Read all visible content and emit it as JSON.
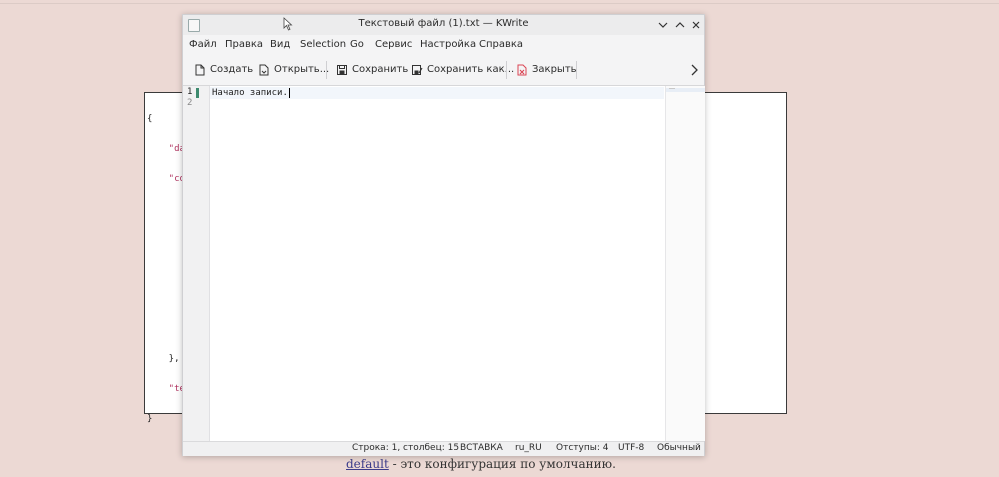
{
  "background": {
    "code_lines": [
      "{",
      "    \"da",
      "    \"co",
      "",
      "",
      "",
      "",
      "",
      "    },",
      "    \"te",
      "}"
    ],
    "footer_link": "default",
    "footer_text": " - это конфигурация по умолчанию."
  },
  "window": {
    "title": "Текстовый файл (1).txt — KWrite",
    "controls": {
      "minimize": "⌄",
      "maximize": "⌃",
      "close": "✕"
    }
  },
  "menu": [
    "Файл",
    "Правка",
    "Вид",
    "Selection",
    "Go",
    "Сервис",
    "Настройка",
    "Справка"
  ],
  "toolbar": {
    "new_label": "Создать",
    "open_label": "Открыть...",
    "save_label": "Сохранить",
    "save_as_label": "Сохранить как...",
    "close_label": "Закрыть",
    "more_icon": "chevron-right-icon"
  },
  "editor": {
    "line_numbers": [
      "1",
      "2"
    ],
    "lines": [
      "Начало записи.",
      ""
    ]
  },
  "status": {
    "position": "Строка: 1, столбец: 15",
    "mode": "ВСТАВКА",
    "dictionary": "ru_RU",
    "indent": "Отступы: 4",
    "encoding": "UTF-8",
    "syntax": "Обычный"
  },
  "colors": {
    "accent_close": "#da4453",
    "modified_marker": "#3d8a6e"
  }
}
